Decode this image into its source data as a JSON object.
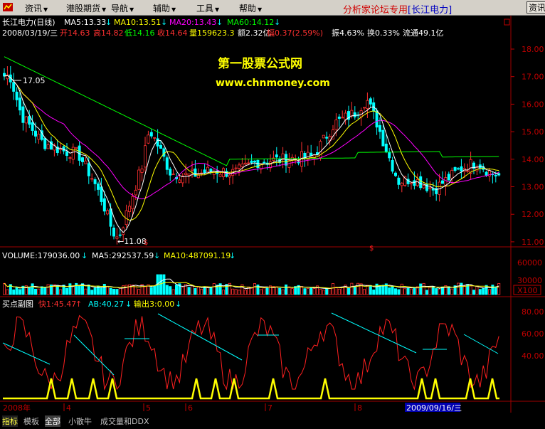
{
  "menu": {
    "items": [
      "资讯",
      "港股期货",
      "导航",
      "辅助",
      "工具",
      "帮助"
    ],
    "right_text": "分析家论坛专用",
    "right_stock": "[长江电力]",
    "button": "资讯"
  },
  "header": {
    "line1": {
      "name": "长江电力(日线)",
      "ma5": "MA5:13.33",
      "ma10": "MA10:13.51",
      "ma20": "MA20:13.43",
      "ma60": "MA60:14.12"
    },
    "line2": {
      "date": "2008/03/19/三",
      "open": "开14.63",
      "high": "高14.82",
      "low": "低14.16",
      "close": "收14.64",
      "vol": "量159623.3",
      "amount": "额2.32亿",
      "change": "幅0.37(2.59%)",
      "amp": "振4.63%",
      "turnover": "换0.33%",
      "float": "流通49.1亿"
    }
  },
  "watermark": {
    "title": "第一股票公式网",
    "url": "www.chnmoney.com"
  },
  "price_annotations": {
    "high_label": "17.05",
    "low_label": "←11.08"
  },
  "price_axis": [
    "18.00",
    "17.00",
    "16.00",
    "15.00",
    "14.00",
    "13.00",
    "12.00",
    "11.00"
  ],
  "volume_header": {
    "vol": "VOLUME:179036.00",
    "ma5": "MA5:292537.59",
    "ma10": "MA10:487091.19"
  },
  "volume_axis": [
    "60000",
    "30000",
    "X100"
  ],
  "indicator_header": {
    "name": "买点副图",
    "fast": "快1:45.47",
    "ab": "AB:40.27",
    "out": "输出3:0.00"
  },
  "indicator_axis": [
    "80.00",
    "60.00",
    "40.00"
  ],
  "date_axis": [
    "2008年",
    "4",
    "5",
    "6",
    "7",
    "8"
  ],
  "date_highlight": "2009/09/16/三",
  "bottom_tabs": [
    "指标",
    "模板",
    "全部",
    "小散牛",
    "成交量和DDX"
  ],
  "colors": {
    "up": "#ff3030",
    "down": "#00ffff",
    "ma5": "#ffffff",
    "ma10": "#ffff00",
    "ma20": "#ff00ff",
    "ma60": "#00ff00"
  }
}
